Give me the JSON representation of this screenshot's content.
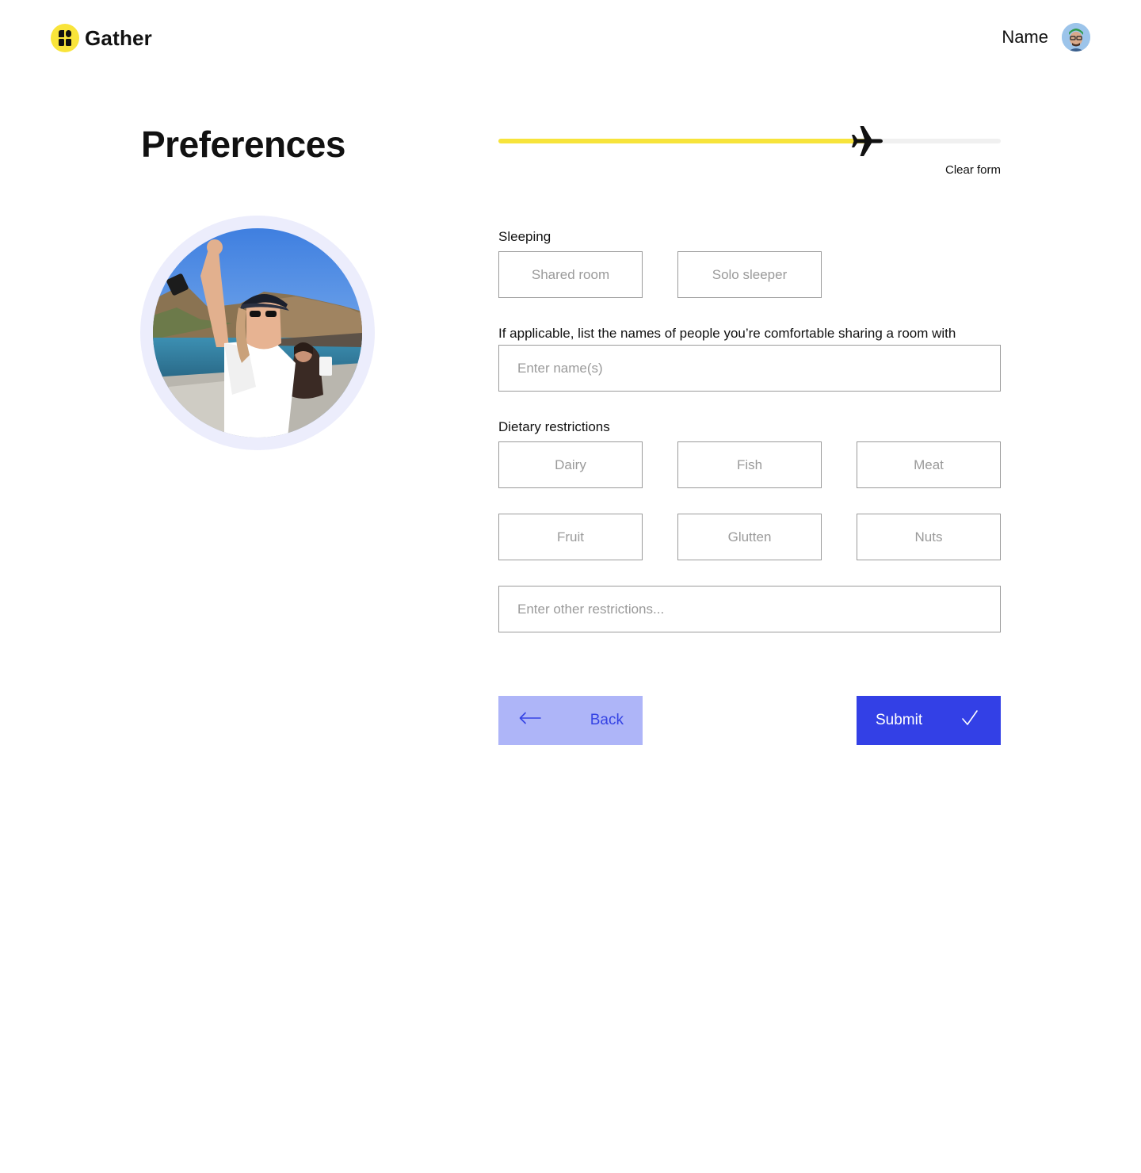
{
  "header": {
    "brand_name": "Gather",
    "user_name": "Name"
  },
  "page": {
    "title": "Preferences"
  },
  "progress": {
    "percent": 74,
    "clear_label": "Clear form"
  },
  "form": {
    "sleeping": {
      "label": "Sleeping",
      "options": [
        "Shared room",
        "Solo sleeper"
      ]
    },
    "roommates": {
      "label": "If applicable, list the names of people you’re comfortable sharing a room with",
      "placeholder": "Enter name(s)"
    },
    "dietary": {
      "label": "Dietary restrictions",
      "options": [
        "Dairy",
        "Fish",
        "Meat",
        "Fruit",
        "Glutten",
        "Nuts"
      ],
      "other_placeholder": "Enter other restrictions..."
    }
  },
  "actions": {
    "back_label": "Back",
    "submit_label": "Submit"
  },
  "colors": {
    "brand_yellow": "#F9E43A",
    "progress_yellow": "#F7E43B",
    "primary_blue": "#3340E6",
    "secondary_blue": "#AEB5F8",
    "ring_lavender": "#ECEDFC"
  }
}
